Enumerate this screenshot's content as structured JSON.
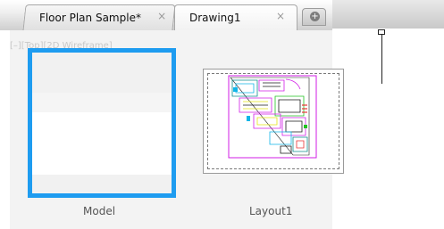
{
  "tabs": [
    {
      "label": "Floor Plan Sample*",
      "close": "×",
      "active": false
    },
    {
      "label": "Drawing1",
      "close": "×",
      "active": true
    }
  ],
  "new_tab_icon": "+",
  "viewport_label": "[–][Top][2D Wireframe]",
  "thumbnails": {
    "model": {
      "caption": "Model",
      "selected": true,
      "border_color": "#1e9cf0"
    },
    "layout": {
      "caption": "Layout1"
    }
  }
}
